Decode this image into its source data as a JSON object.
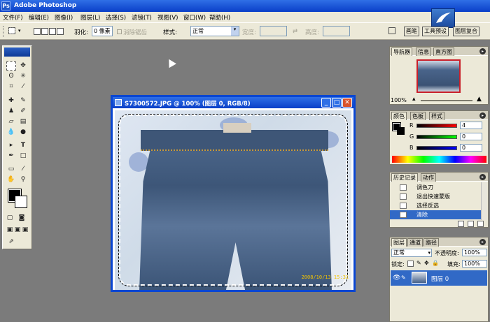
{
  "app": {
    "title": "Adobe Photoshop",
    "icon": "ps-icon"
  },
  "menu": [
    "文件(F)",
    "编辑(E)",
    "图像(I)",
    "图层(L)",
    "选择(S)",
    "滤镜(T)",
    "视图(V)",
    "窗口(W)",
    "帮助(H)"
  ],
  "options": {
    "feather_label": "羽化:",
    "feather_value": "0 像素",
    "antialias_label": "消除锯齿",
    "style_label": "样式:",
    "style_value": "正常",
    "width_label": "宽度:",
    "height_label": "高度:"
  },
  "dock": [
    "画笔",
    "工具预设",
    "图层复合"
  ],
  "document": {
    "title": "S7300572.JPG @ 100% (图层 0, RGB/8)",
    "datestamp": "2008/10/13 15:31"
  },
  "navigator": {
    "tabs": [
      "导航器",
      "信息",
      "直方图"
    ],
    "zoom": "100%"
  },
  "color": {
    "tabs": [
      "颜色",
      "色板",
      "样式"
    ],
    "r_label": "R",
    "r_value": "4",
    "g_label": "G",
    "g_value": "0",
    "b_label": "B",
    "b_value": "0",
    "r": 0.02,
    "g": 0,
    "b": 0
  },
  "history": {
    "tabs": [
      "历史记录",
      "动作"
    ],
    "items": [
      "调色刀",
      "退出快速蒙版",
      "选择反选",
      "清除"
    ]
  },
  "layers": {
    "tabs": [
      "图层",
      "通道",
      "路径"
    ],
    "blend_mode": "正常",
    "opacity_label": "不透明度:",
    "opacity_value": "100%",
    "lock_label": "锁定:",
    "fill_label": "填充:",
    "fill_value": "100%",
    "layer_name": "图层 0"
  }
}
